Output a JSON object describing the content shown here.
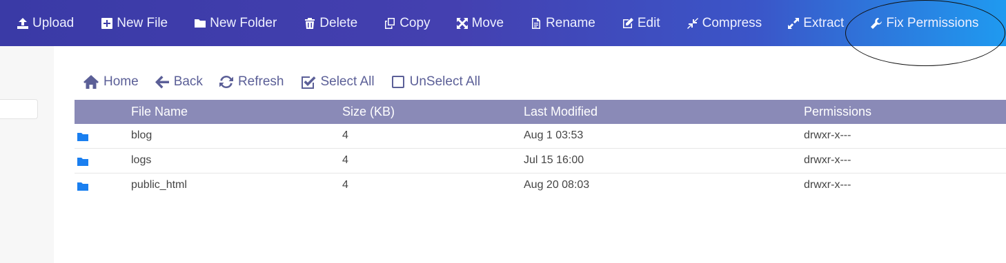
{
  "toolbar": {
    "upload": "Upload",
    "new_file": "New File",
    "new_folder": "New Folder",
    "delete": "Delete",
    "copy": "Copy",
    "move": "Move",
    "rename": "Rename",
    "edit": "Edit",
    "compress": "Compress",
    "extract": "Extract",
    "fix_permissions": "Fix Permissions"
  },
  "actions": {
    "home": "Home",
    "back": "Back",
    "refresh": "Refresh",
    "select_all": "Select All",
    "unselect_all": "UnSelect All"
  },
  "table": {
    "headers": [
      "File Name",
      "Size (KB)",
      "Last Modified",
      "Permissions"
    ],
    "rows": [
      {
        "name": "blog",
        "size": "4",
        "modified": "Aug 1 03:53",
        "permissions": "drwxr-x---"
      },
      {
        "name": "logs",
        "size": "4",
        "modified": "Jul 15 16:00",
        "permissions": "drwxr-x---"
      },
      {
        "name": "public_html",
        "size": "4",
        "modified": "Aug 20 08:03",
        "permissions": "drwxr-x---"
      }
    ]
  },
  "colors": {
    "toolbar_start": "#3a3aa6",
    "toolbar_end": "#1f9af0",
    "table_header": "#8a8ab7",
    "action_text": "#5b5f97",
    "folder_icon": "#1a7ff0"
  }
}
